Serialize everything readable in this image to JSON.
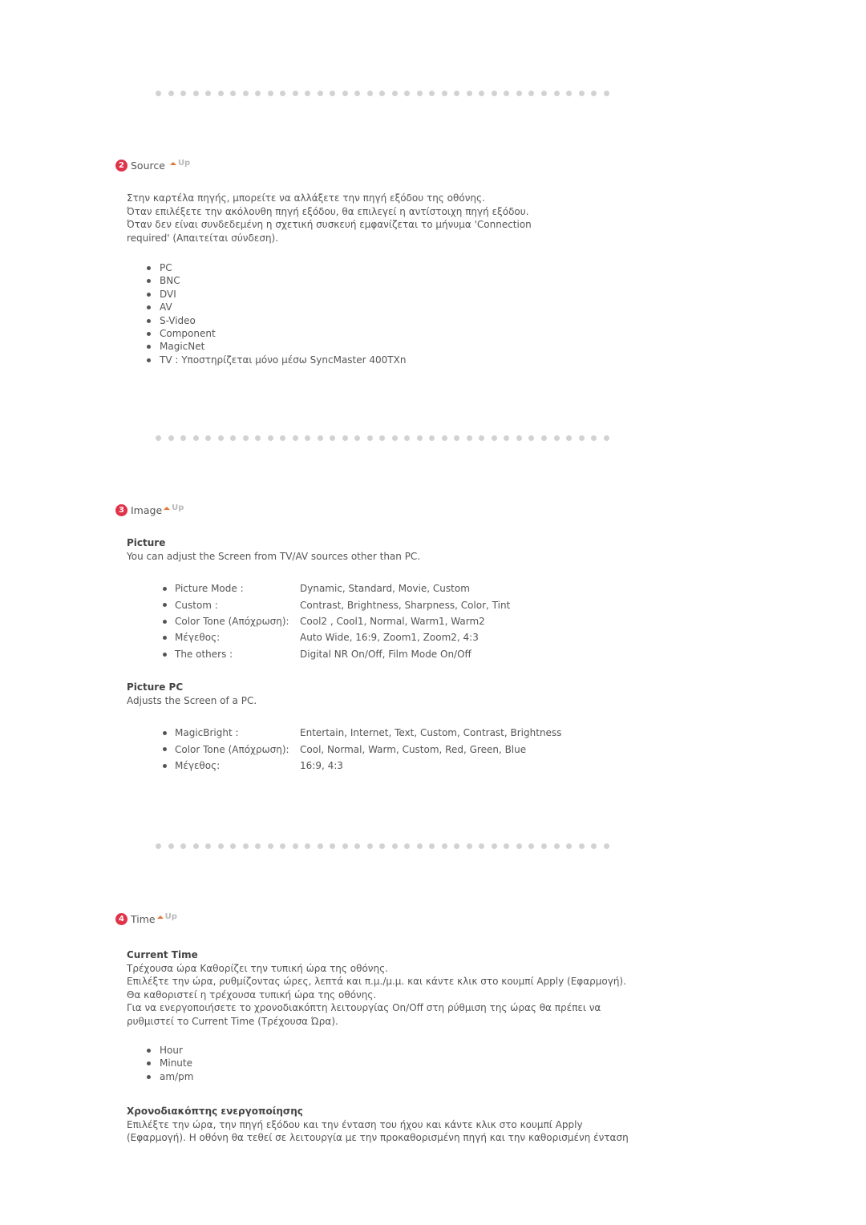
{
  "sections": {
    "source": {
      "number": "2",
      "title": "Source",
      "up_label": "Up",
      "paragraph_lines": [
        "Στην καρτέλα πηγής, μπορείτε να αλλάξετε την πηγή εξόδου της οθόνης.",
        "Όταν επιλέξετε την ακόλουθη πηγή εξόδου, θα επιλεγεί η αντίστοιχη πηγή εξόδου.",
        "Όταν δεν είναι συνδεδεμένη η σχετική συσκευή εμφανίζεται το μήνυμα 'Connection",
        "required' (Απαιτείται σύνδεση)."
      ],
      "items": [
        "PC",
        "BNC",
        "DVI",
        "AV",
        "S-Video",
        "Component",
        "MagicNet",
        "TV : Υποστηρίζεται μόνο μέσω SyncMaster 400TXn"
      ]
    },
    "image": {
      "number": "3",
      "title": "Image",
      "up_label": "Up",
      "picture": {
        "title": "Picture",
        "description": "You can adjust the Screen from TV/AV sources other than PC.",
        "rows": [
          {
            "key": "Picture Mode :",
            "value": "Dynamic, Standard, Movie, Custom"
          },
          {
            "key": "Custom :",
            "value": "Contrast, Brightness, Sharpness, Color, Tint"
          },
          {
            "key": "Color Tone (Απόχρωση):",
            "value": "Cool2 , Cool1, Normal, Warm1, Warm2"
          },
          {
            "key": "Μέγεθος:",
            "value": "Auto Wide, 16:9, Zoom1, Zoom2, 4:3"
          },
          {
            "key": "The others :",
            "value": "Digital NR On/Off, Film Mode On/Off"
          }
        ]
      },
      "picture_pc": {
        "title": "Picture PC",
        "description": "Adjusts the Screen of a PC.",
        "rows": [
          {
            "key": "MagicBright :",
            "value": "Entertain, Internet, Text, Custom, Contrast, Brightness"
          },
          {
            "key": "Color Tone (Απόχρωση):",
            "value": "Cool, Normal, Warm, Custom, Red, Green, Blue"
          },
          {
            "key": "Μέγεθος:",
            "value": "16:9, 4:3"
          }
        ]
      }
    },
    "time": {
      "number": "4",
      "title": "Time",
      "up_label": "Up",
      "current_time": {
        "title": "Current Time",
        "lines": [
          "Τρέχουσα ώρα Καθορίζει την τυπική ώρα της οθόνης.",
          "Επιλέξτε την ώρα, ρυθμίζοντας ώρες, λεπτά και π.μ./μ.μ. και κάντε κλικ στο κουμπί Apply (Εφαρμογή).",
          "Θα καθοριστεί η τρέχουσα τυπική ώρα της οθόνης.",
          "Για να ενεργοποιήσετε το χρονοδιακόπτη λειτουργίας On/Off στη ρύθμιση της ώρας θα πρέπει να",
          "ρυθμιστεί το Current Time (Τρέχουσα Ώρα)."
        ],
        "items": [
          "Hour",
          "Minute",
          "am/pm"
        ]
      },
      "on_timer": {
        "title": "Χρονοδιακόπτης ενεργοποίησης",
        "lines": [
          "Επιλέξτε την ώρα, την πηγή εξόδου και την ένταση του ήχου και κάντε κλικ στο κουμπί Apply",
          "(Εφαρμογή). Η οθόνη θα τεθεί σε λειτουργία με την προκαθορισμένη πηγή και την καθορισμένη ένταση"
        ]
      }
    }
  },
  "colors": {
    "number_badge": "#e0334a",
    "up_arrow": "#e8743b",
    "separator_dot": "#d2d2d2",
    "text": "#555555"
  }
}
